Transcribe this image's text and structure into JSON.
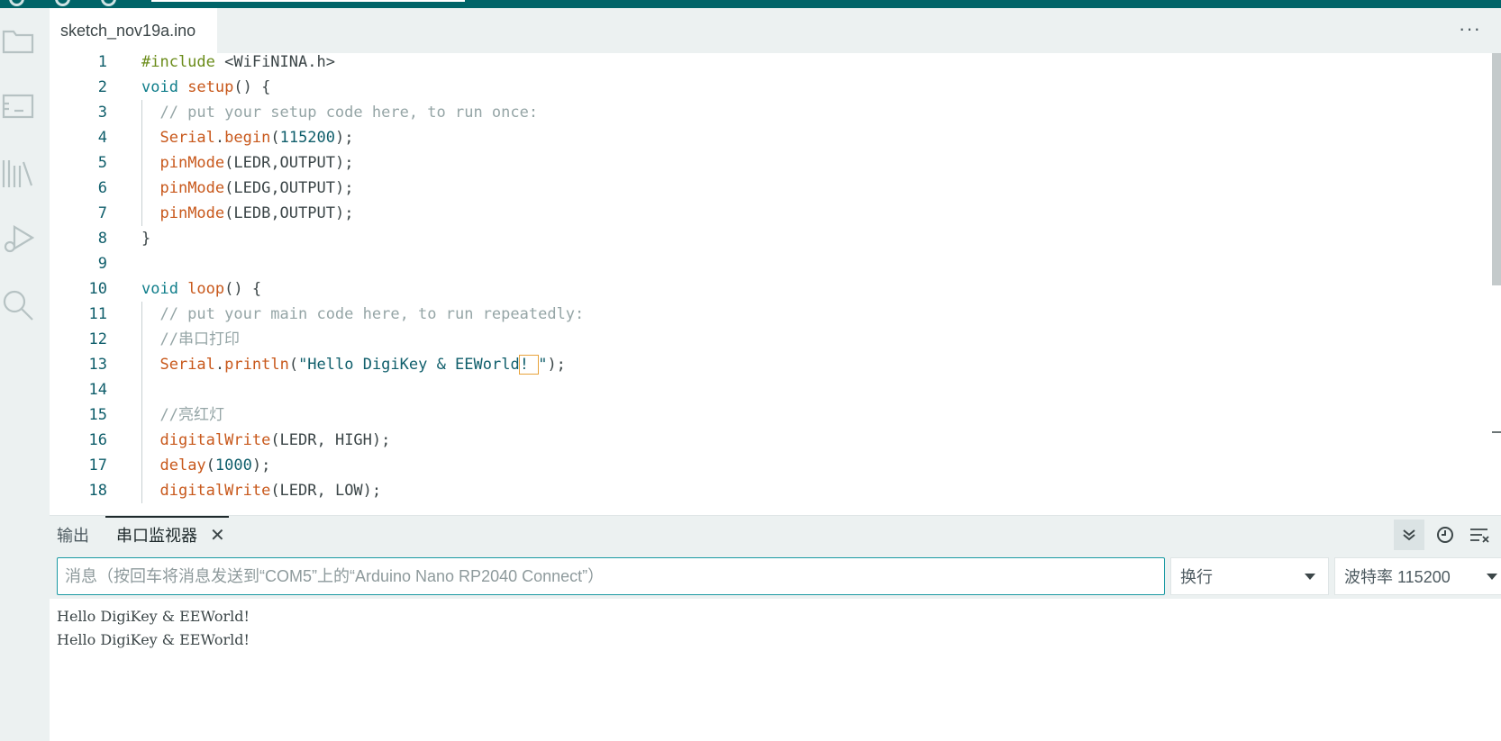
{
  "window": {
    "top_color": "#006468",
    "accent": "#1a9aa3"
  },
  "sidebar": {
    "icons": [
      "sketchbook-folder-icon",
      "boards-manager-icon",
      "library-manager-icon",
      "debug-icon",
      "search-icon"
    ]
  },
  "editor_tabs": [
    {
      "label": "sketch_nov19a.ino"
    }
  ],
  "more_menu": "···",
  "code_lines": [
    {
      "n": "1",
      "tokens": [
        [
          "pp",
          "#include "
        ],
        [
          "tx",
          "<WiFiNINA.h>"
        ]
      ]
    },
    {
      "n": "2",
      "tokens": [
        [
          "kw",
          "void "
        ],
        [
          "fn",
          "setup"
        ],
        [
          "tx",
          "() {"
        ]
      ]
    },
    {
      "n": "3",
      "tokens": [
        [
          "cm",
          "  // put your setup code here, to run once:"
        ]
      ]
    },
    {
      "n": "4",
      "tokens": [
        [
          "tx",
          "  "
        ],
        [
          "obj",
          "Serial"
        ],
        [
          "tx",
          "."
        ],
        [
          "fn",
          "begin"
        ],
        [
          "tx",
          "("
        ],
        [
          "num",
          "115200"
        ],
        [
          "tx",
          ");"
        ]
      ]
    },
    {
      "n": "5",
      "tokens": [
        [
          "tx",
          "  "
        ],
        [
          "fn",
          "pinMode"
        ],
        [
          "tx",
          "(LEDR,OUTPUT);"
        ]
      ]
    },
    {
      "n": "6",
      "tokens": [
        [
          "tx",
          "  "
        ],
        [
          "fn",
          "pinMode"
        ],
        [
          "tx",
          "(LEDG,OUTPUT);"
        ]
      ]
    },
    {
      "n": "7",
      "tokens": [
        [
          "tx",
          "  "
        ],
        [
          "fn",
          "pinMode"
        ],
        [
          "tx",
          "(LEDB,OUTPUT);"
        ]
      ]
    },
    {
      "n": "8",
      "tokens": [
        [
          "tx",
          "}"
        ]
      ]
    },
    {
      "n": "9",
      "tokens": []
    },
    {
      "n": "10",
      "tokens": [
        [
          "kw",
          "void "
        ],
        [
          "fn",
          "loop"
        ],
        [
          "tx",
          "() {"
        ]
      ]
    },
    {
      "n": "11",
      "tokens": [
        [
          "cm",
          "  // put your main code here, to run repeatedly:"
        ]
      ]
    },
    {
      "n": "12",
      "tokens": [
        [
          "cm",
          "  //串口打印"
        ]
      ]
    },
    {
      "n": "13",
      "tokens": [
        [
          "tx",
          "  "
        ],
        [
          "obj",
          "Serial"
        ],
        [
          "tx",
          "."
        ],
        [
          "fn",
          "println"
        ],
        [
          "tx",
          "("
        ],
        [
          "str",
          "\"Hello DigiKey & EEWorld"
        ],
        [
          "box",
          "! "
        ],
        [
          "str",
          "\""
        ],
        [
          "tx",
          ");"
        ]
      ]
    },
    {
      "n": "14",
      "tokens": []
    },
    {
      "n": "15",
      "tokens": [
        [
          "cm",
          "  //亮红灯"
        ]
      ]
    },
    {
      "n": "16",
      "tokens": [
        [
          "tx",
          "  "
        ],
        [
          "fn",
          "digitalWrite"
        ],
        [
          "tx",
          "(LEDR, HIGH);"
        ]
      ]
    },
    {
      "n": "17",
      "tokens": [
        [
          "tx",
          "  "
        ],
        [
          "fn",
          "delay"
        ],
        [
          "tx",
          "("
        ],
        [
          "num",
          "1000"
        ],
        [
          "tx",
          ");"
        ]
      ]
    },
    {
      "n": "18",
      "tokens": [
        [
          "tx",
          "  "
        ],
        [
          "fn",
          "digitalWrite"
        ],
        [
          "tx",
          "(LEDR, LOW);"
        ]
      ]
    }
  ],
  "panel": {
    "tabs": [
      {
        "label": "输出",
        "active": false
      },
      {
        "label": "串口监视器",
        "active": true
      }
    ],
    "close_glyph": "✕",
    "message_placeholder": "消息（按回车将消息发送到“COM5”上的“Arduino Nano RP2040 Connect”）",
    "line_ending": "换行",
    "baud_rate": "波特率 115200",
    "buttons": [
      {
        "name": "autoscroll-button",
        "glyph": "⌄",
        "active": true
      },
      {
        "name": "timestamp-button",
        "glyph": "◷",
        "active": false
      },
      {
        "name": "clear-output-button",
        "glyph": "≡",
        "active": false
      }
    ]
  },
  "serial_output": [
    "Hello DigiKey & EEWorld!",
    "Hello DigiKey & EEWorld!"
  ]
}
